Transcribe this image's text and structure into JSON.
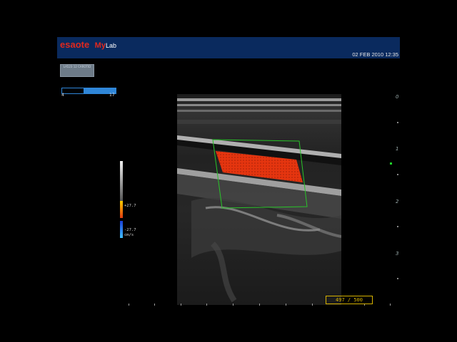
{
  "header": {
    "brand": "esaote",
    "product_my": "My",
    "product_lab": "Lab",
    "datetime": "02 FEB 2010 12:35"
  },
  "probe_box": {
    "line1": "LA523 12 CAROTID",
    "line2": ""
  },
  "frequency": {
    "min": "4",
    "max": "17",
    "level_fraction": 0.6
  },
  "color_scale": {
    "pos": "+27.7",
    "neg": "-27.7",
    "unit": "cm/s"
  },
  "depth_markers": [
    "0",
    "1",
    "2",
    "3"
  ],
  "frame_counter": "497 / 500",
  "colors": {
    "header_bg": "#0a2a5e",
    "brand_red": "#e0281e",
    "roi_green": "#29c429",
    "flow_red": "#e5350f",
    "counter_yellow": "#d6b200"
  }
}
